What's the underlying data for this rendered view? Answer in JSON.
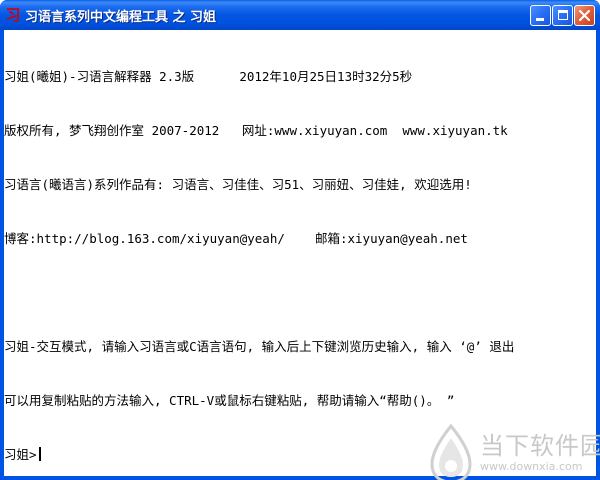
{
  "window": {
    "title": "习语言系列中文编程工具 之 习姐",
    "app_icon_glyph": "习",
    "icons": {
      "minimize": "minimize-icon",
      "maximize": "maximize-icon",
      "close": "close-icon"
    },
    "colors": {
      "titlebar": "#0054e3",
      "close_button": "#e2613d",
      "app_icon": "#d40000"
    }
  },
  "console": {
    "lines": [
      "习姐(曦姐)-习语言解释器 2.3版      2012年10月25日13时32分5秒",
      "版权所有, 梦飞翔创作室 2007-2012   网址:www.xiyuyan.com  www.xiyuyan.tk",
      "习语言(曦语言)系列作品有: 习语言、习佳佳、习51、习丽妞、习佳娃, 欢迎选用!",
      "博客:http://blog.163.com/xiyuyan@yeah/    邮箱:xiyuyan@yeah.net",
      "",
      "习姐-交互模式, 请输入习语言或C语言语句, 输入后上下键浏览历史输入, 输入 ‘@’ 退出",
      "可以用复制粘贴的方法输入, CTRL-V或鼠标右键粘贴, 帮助请输入“帮助()。 ”"
    ],
    "prompt": "习姐>"
  },
  "watermark": {
    "name": "当下软件园",
    "url": "www.downxia.com"
  }
}
